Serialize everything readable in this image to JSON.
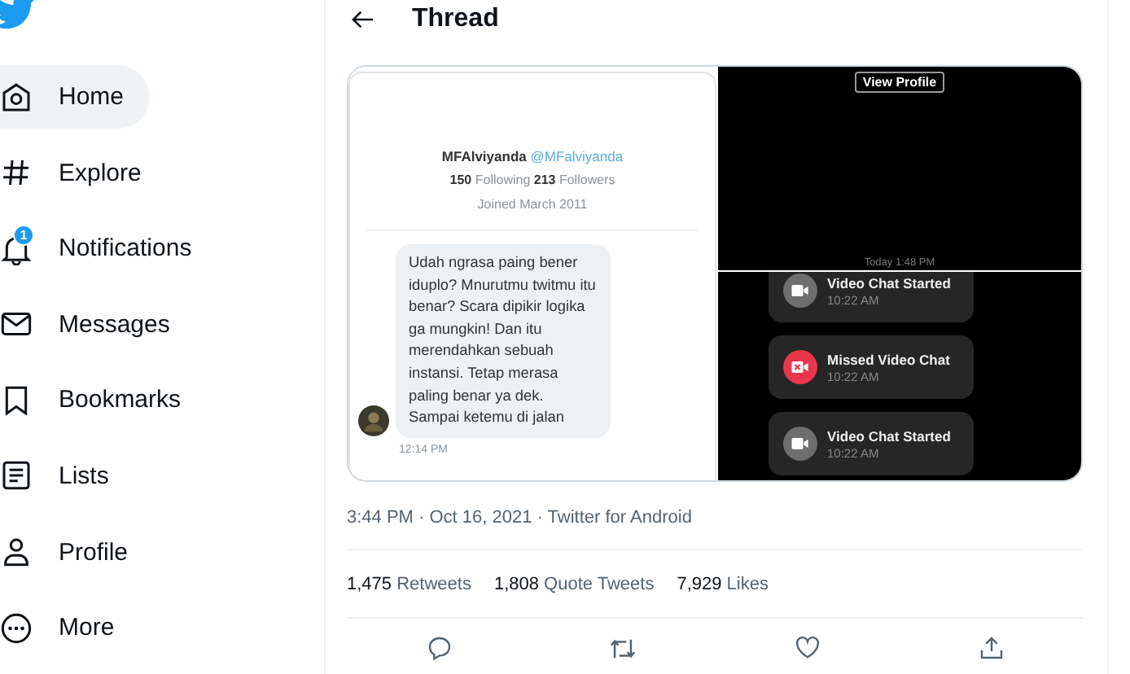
{
  "sidebar": {
    "items": [
      {
        "label": "Home",
        "selected": true
      },
      {
        "label": "Explore",
        "selected": false
      },
      {
        "label": "Notifications",
        "selected": false,
        "badge": "1"
      },
      {
        "label": "Messages",
        "selected": false
      },
      {
        "label": "Bookmarks",
        "selected": false
      },
      {
        "label": "Lists",
        "selected": false
      },
      {
        "label": "Profile",
        "selected": false
      },
      {
        "label": "More",
        "selected": false
      }
    ]
  },
  "header": {
    "title": "Thread"
  },
  "media": {
    "dm_screenshot": {
      "name": "MFAlviyanda",
      "handle": "@MFalviyanda",
      "stats": "**150** Following **213** Followers",
      "joined": "Joined March 2011",
      "message": "Udah ngrasa paing bener iduplo? Mnurutmu twitmu itu benar? Scara dipikir logika ga mungkin! Dan itu merendahkan sebuah instansi. Tetap merasa paling benar ya dek. Sampai ketemu di jalan",
      "time": "12:14 PM"
    },
    "profile_screenshot": {
      "button": "View Profile",
      "timestamp": "Today 1:48 PM"
    },
    "calls_screenshot": {
      "calls": [
        {
          "kind": "started",
          "title": "Video Chat Started",
          "time": "10:22 AM"
        },
        {
          "kind": "missed",
          "title": "Missed Video Chat",
          "time": "10:22 AM"
        },
        {
          "kind": "started",
          "title": "Video Chat Started",
          "time": "10:22 AM"
        }
      ]
    }
  },
  "meta": "3:44 PM · Oct 16, 2021 · Twitter for Android",
  "stats": [
    {
      "count": "1,475",
      "label": "Retweets"
    },
    {
      "count": "1,808",
      "label": "Quote Tweets"
    },
    {
      "count": "7,929",
      "label": "Likes"
    }
  ]
}
